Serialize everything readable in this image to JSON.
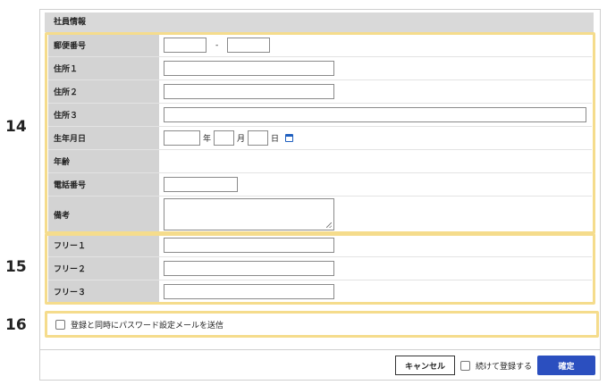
{
  "section": {
    "title": "社員情報"
  },
  "fields": {
    "postal": {
      "label": "郵便番号",
      "separator": "-"
    },
    "address1": {
      "label": "住所１"
    },
    "address2": {
      "label": "住所２"
    },
    "address3": {
      "label": "住所３"
    },
    "birthdate": {
      "label": "生年月日",
      "year_unit": "年",
      "month_unit": "月",
      "day_unit": "日"
    },
    "age": {
      "label": "年齢"
    },
    "phone": {
      "label": "電話番号"
    },
    "notes": {
      "label": "備考"
    },
    "free1": {
      "label": "フリー１"
    },
    "free2": {
      "label": "フリー２"
    },
    "free3": {
      "label": "フリー３"
    }
  },
  "markers": {
    "m14": "14",
    "m15": "15",
    "m16": "16"
  },
  "password_option": {
    "label": "登録と同時にパスワード設定メールを送信",
    "checked": false
  },
  "footer": {
    "cancel_label": "キャンセル",
    "continue_label": "続けて登録する",
    "confirm_label": "確定"
  },
  "colors": {
    "highlight": "#f5dc8c",
    "primary": "#2b4fbf",
    "label_bg": "#d3d3d3"
  }
}
